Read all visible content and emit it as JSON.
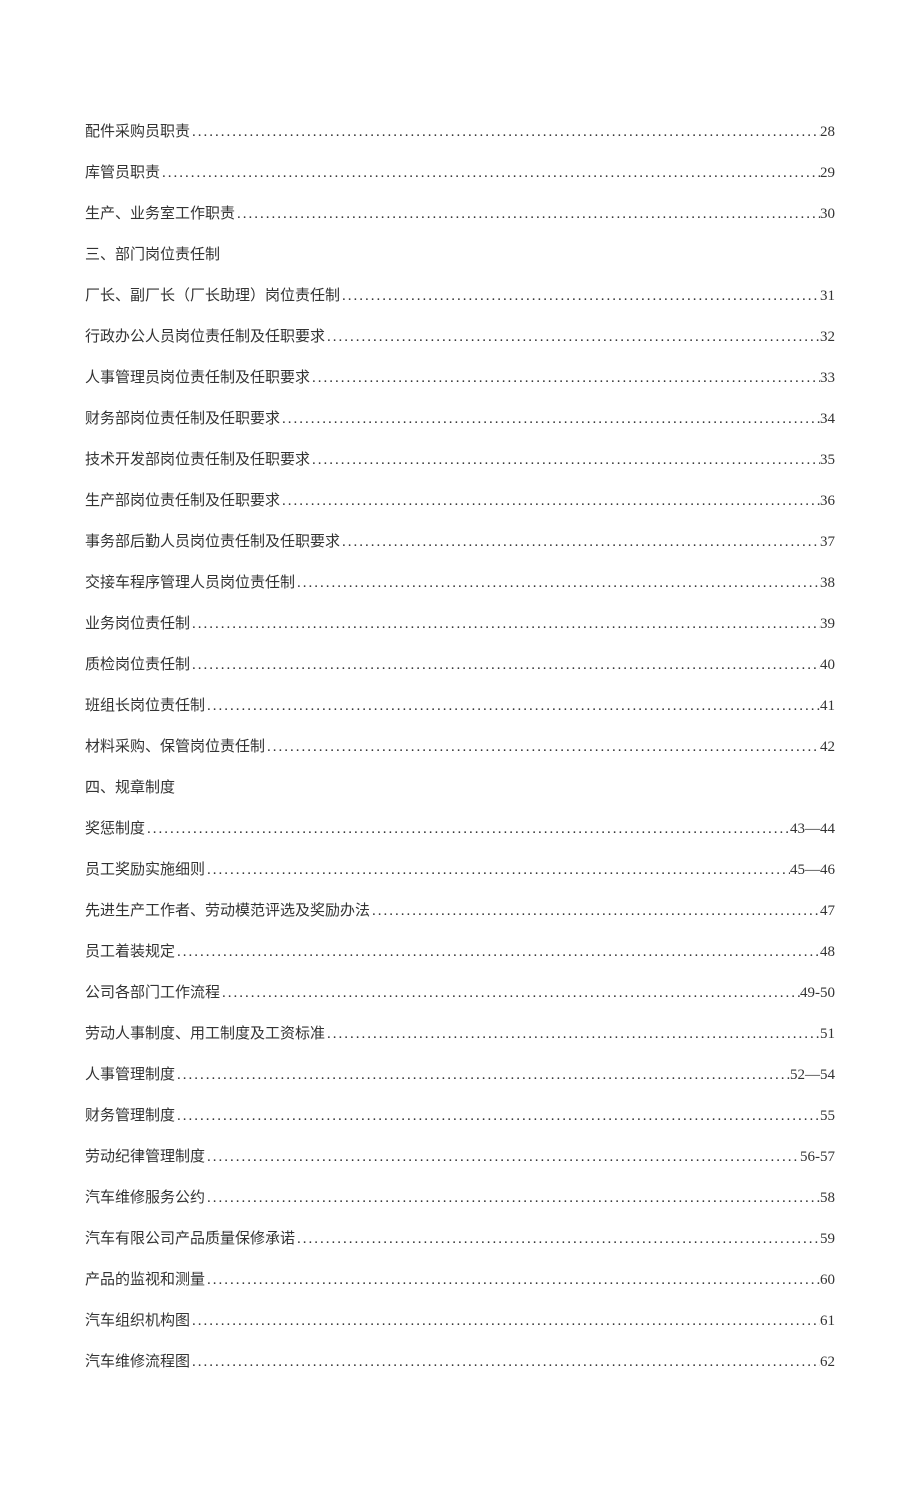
{
  "toc": [
    {
      "type": "entry",
      "title": "配件采购员职责",
      "page": "28"
    },
    {
      "type": "entry",
      "title": "库管员职责",
      "page": "29"
    },
    {
      "type": "entry",
      "title": "生产、业务室工作职责",
      "page": "30"
    },
    {
      "type": "heading",
      "title": "三、部门岗位责任制"
    },
    {
      "type": "entry",
      "title": "厂长、副厂长（厂长助理）岗位责任制",
      "page": "31"
    },
    {
      "type": "entry",
      "title": "行政办公人员岗位责任制及任职要求",
      "page": "32"
    },
    {
      "type": "entry",
      "title": "人事管理员岗位责任制及任职要求",
      "page": "33"
    },
    {
      "type": "entry",
      "title": "财务部岗位责任制及任职要求",
      "page": "34"
    },
    {
      "type": "entry",
      "title": "技术开发部岗位责任制及任职要求",
      "page": "35"
    },
    {
      "type": "entry",
      "title": "生产部岗位责任制及任职要求",
      "page": "36"
    },
    {
      "type": "entry",
      "title": "事务部后勤人员岗位责任制及任职要求",
      "page": "37"
    },
    {
      "type": "entry",
      "title": "交接车程序管理人员岗位责任制",
      "page": "38"
    },
    {
      "type": "entry",
      "title": "业务岗位责任制",
      "page": "39"
    },
    {
      "type": "entry",
      "title": "质检岗位责任制",
      "page": "40"
    },
    {
      "type": "entry",
      "title": "班组长岗位责任制",
      "page": "41"
    },
    {
      "type": "entry",
      "title": "材料采购、保管岗位责任制",
      "page": "42"
    },
    {
      "type": "heading",
      "title": "四、规章制度"
    },
    {
      "type": "entry",
      "title": "奖惩制度",
      "page": "43—44"
    },
    {
      "type": "entry",
      "title": "员工奖励实施细则",
      "page": "45—46"
    },
    {
      "type": "entry",
      "title": "先进生产工作者、劳动模范评选及奖励办法",
      "page": "47"
    },
    {
      "type": "entry",
      "title": "员工着装规定",
      "page": "48"
    },
    {
      "type": "entry",
      "title": "公司各部门工作流程",
      "page": "49-50"
    },
    {
      "type": "entry",
      "title": "劳动人事制度、用工制度及工资标准",
      "page": "51"
    },
    {
      "type": "entry",
      "title": "人事管理制度",
      "page": "52—54"
    },
    {
      "type": "entry",
      "title": "财务管理制度",
      "page": "55"
    },
    {
      "type": "entry",
      "title": "劳动纪律管理制度",
      "page": "56-57"
    },
    {
      "type": "entry",
      "title": "汽车维修服务公约",
      "page": "58"
    },
    {
      "type": "entry",
      "title": "汽车有限公司产品质量保修承诺",
      "page": "59"
    },
    {
      "type": "entry",
      "title": "产品的监视和测量",
      "page": "60"
    },
    {
      "type": "entry",
      "title": "汽车组织机构图",
      "page": "61"
    },
    {
      "type": "entry",
      "title": "汽车维修流程图",
      "page": "62"
    }
  ]
}
